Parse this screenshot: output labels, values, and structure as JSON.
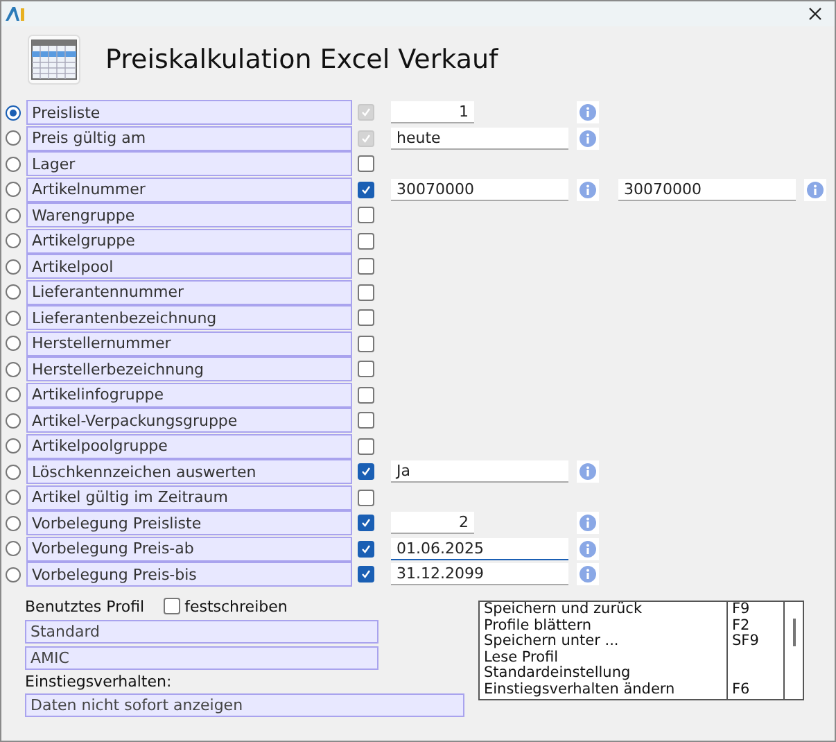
{
  "window": {
    "title": "Preiskalkulation Excel Verkauf"
  },
  "rows": [
    {
      "label": "Preisliste",
      "selected": true,
      "checked": true,
      "disabled": true,
      "fields": [
        {
          "kind": "number",
          "value": "1",
          "focused": false
        }
      ]
    },
    {
      "label": "Preis gültig am",
      "selected": false,
      "checked": true,
      "disabled": true,
      "fields": [
        {
          "kind": "text",
          "value": "heute",
          "focused": false
        }
      ]
    },
    {
      "label": "Lager",
      "selected": false,
      "checked": false,
      "disabled": false,
      "fields": []
    },
    {
      "label": "Artikelnummer",
      "selected": false,
      "checked": true,
      "disabled": false,
      "fields": [
        {
          "kind": "text",
          "value": "30070000",
          "focused": false
        },
        {
          "kind": "text",
          "value": "30070000",
          "focused": false
        }
      ]
    },
    {
      "label": "Warengruppe",
      "selected": false,
      "checked": false,
      "disabled": false,
      "fields": []
    },
    {
      "label": "Artikelgruppe",
      "selected": false,
      "checked": false,
      "disabled": false,
      "fields": []
    },
    {
      "label": "Artikelpool",
      "selected": false,
      "checked": false,
      "disabled": false,
      "fields": []
    },
    {
      "label": "Lieferantennummer",
      "selected": false,
      "checked": false,
      "disabled": false,
      "fields": []
    },
    {
      "label": "Lieferantenbezeichnung",
      "selected": false,
      "checked": false,
      "disabled": false,
      "fields": []
    },
    {
      "label": "Herstellernummer",
      "selected": false,
      "checked": false,
      "disabled": false,
      "fields": []
    },
    {
      "label": "Herstellerbezeichnung",
      "selected": false,
      "checked": false,
      "disabled": false,
      "fields": []
    },
    {
      "label": "Artikelinfogruppe",
      "selected": false,
      "checked": false,
      "disabled": false,
      "fields": []
    },
    {
      "label": "Artikel-Verpackungsgruppe",
      "selected": false,
      "checked": false,
      "disabled": false,
      "fields": []
    },
    {
      "label": "Artikelpoolgruppe",
      "selected": false,
      "checked": false,
      "disabled": false,
      "fields": []
    },
    {
      "label": "Löschkennzeichen auswerten",
      "selected": false,
      "checked": true,
      "disabled": false,
      "fields": [
        {
          "kind": "text",
          "value": "Ja",
          "focused": false
        }
      ]
    },
    {
      "label": "Artikel gültig im Zeitraum",
      "selected": false,
      "checked": false,
      "disabled": false,
      "fields": []
    },
    {
      "label": "Vorbelegung Preisliste",
      "selected": false,
      "checked": true,
      "disabled": false,
      "fields": [
        {
          "kind": "number",
          "value": "2",
          "focused": false
        }
      ]
    },
    {
      "label": "Vorbelegung Preis-ab",
      "selected": false,
      "checked": true,
      "disabled": false,
      "fields": [
        {
          "kind": "text",
          "value": "01.06.2025",
          "focused": true
        }
      ]
    },
    {
      "label": "Vorbelegung Preis-bis",
      "selected": false,
      "checked": true,
      "disabled": false,
      "fields": [
        {
          "kind": "text",
          "value": "31.12.2099",
          "focused": false
        }
      ]
    }
  ],
  "profile": {
    "label": "Benutztes Profil",
    "lock": {
      "label": "festschreiben",
      "checked": false
    },
    "values": [
      "Standard",
      "AMIC"
    ],
    "entry_label": "Einstiegsverhalten:",
    "entry_value": "Daten nicht sofort anzeigen"
  },
  "menu": [
    {
      "label": "Speichern und zurück",
      "key": "F9"
    },
    {
      "label": "Profile blättern",
      "key": "F2"
    },
    {
      "label": "Speichern unter ...",
      "key": "SF9"
    },
    {
      "label": "Lese Profil"
    },
    {
      "label": "Standardeinstellung"
    },
    {
      "label": "Einstiegsverhalten ändern",
      "key": "F6"
    }
  ]
}
